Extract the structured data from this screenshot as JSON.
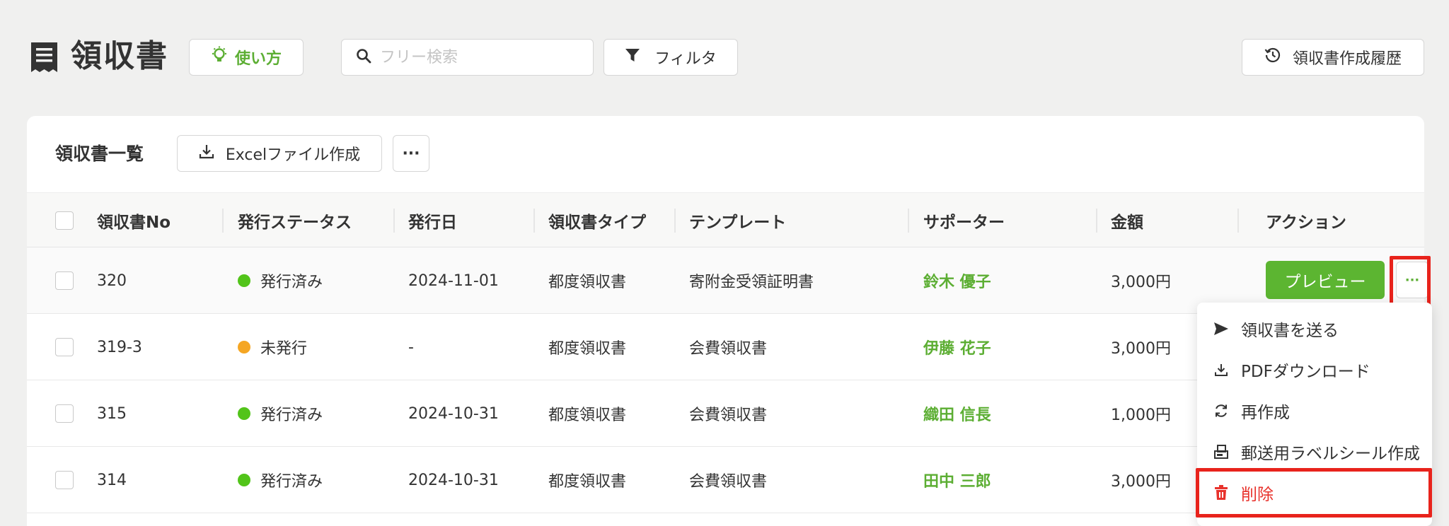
{
  "header": {
    "title": "領収書",
    "howto_label": "使い方",
    "search_placeholder": "フリー検索",
    "filter_label": "フィルタ",
    "history_label": "領収書作成履歴"
  },
  "card": {
    "title": "領収書一覧",
    "excel_label": "Excelファイル作成",
    "more_label": "···"
  },
  "columns": [
    "領収書No",
    "発行ステータス",
    "発行日",
    "領収書タイプ",
    "テンプレート",
    "サポーター",
    "金額",
    "アクション"
  ],
  "rows": [
    {
      "no": "320",
      "status": "発行済み",
      "status_color": "#52c41a",
      "date": "2024-11-01",
      "type": "都度領収書",
      "template": "寄附金受領証明書",
      "supporter": "鈴木 優子",
      "amount": "3,000円"
    },
    {
      "no": "319-3",
      "status": "未発行",
      "status_color": "#f5a623",
      "date": "-",
      "type": "都度領収書",
      "template": "会費領収書",
      "supporter": "伊藤 花子",
      "amount": "3,000円"
    },
    {
      "no": "315",
      "status": "発行済み",
      "status_color": "#52c41a",
      "date": "2024-10-31",
      "type": "都度領収書",
      "template": "会費領収書",
      "supporter": "織田 信長",
      "amount": "1,000円"
    },
    {
      "no": "314",
      "status": "発行済み",
      "status_color": "#52c41a",
      "date": "2024-10-31",
      "type": "都度領収書",
      "template": "会費領収書",
      "supporter": "田中 三郎",
      "amount": "3,000円"
    }
  ],
  "action": {
    "preview_label": "プレビュー",
    "more_label": "···"
  },
  "menu": {
    "items": [
      {
        "label": "領収書を送る",
        "icon": "send-icon"
      },
      {
        "label": "PDFダウンロード",
        "icon": "download-icon"
      },
      {
        "label": "再作成",
        "icon": "refresh-icon"
      },
      {
        "label": "郵送用ラベルシール作成",
        "icon": "label-print-icon"
      },
      {
        "label": "削除",
        "icon": "trash-icon"
      }
    ]
  },
  "colors": {
    "accent_green": "#5cb531",
    "danger_red": "#e8322c",
    "highlight_red": "#e8231c"
  }
}
